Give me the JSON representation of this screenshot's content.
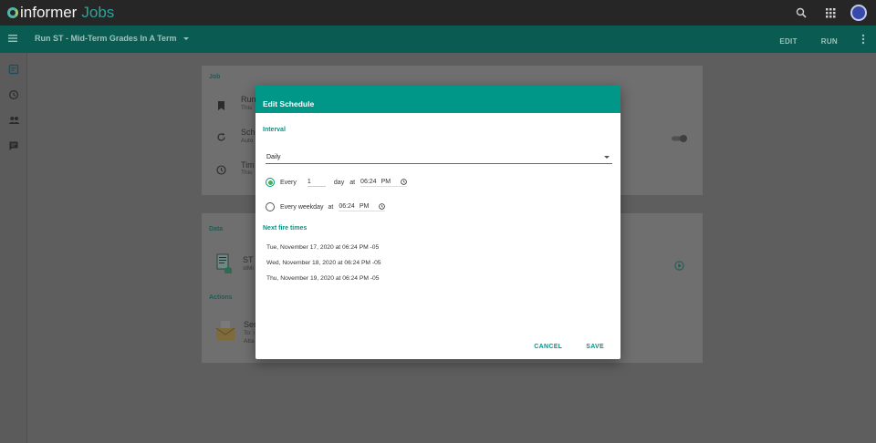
{
  "topbar": {
    "logo_text": "informer",
    "logo_sub": "Jobs"
  },
  "header": {
    "title": "Run ST - Mid-Term Grades In A Term",
    "edit_label": "EDIT",
    "run_label": "RUN"
  },
  "background": {
    "job_section": "Job",
    "row1_title": "Run",
    "row1_sub": "This",
    "row2_title": "Sch",
    "row2_sub": "Auto",
    "row3_title": "Tim",
    "row3_sub": "This",
    "data_section": "Data",
    "data_title": "ST -",
    "data_sub": "stMi",
    "actions_section": "Actions",
    "action_title": "Sen",
    "action_sub1": "To: \\",
    "action_sub2": "Atta"
  },
  "dialog": {
    "title": "Edit Schedule",
    "interval_label": "Interval",
    "interval_value": "Daily",
    "every_label": "Every",
    "every_value": "1",
    "day_label": "day",
    "at_label": "at",
    "time_value": "06:24",
    "time_ampm": "PM",
    "weekday_label": "Every weekday",
    "weekday_at_label": "at",
    "weekday_time": "06:24",
    "weekday_ampm": "PM",
    "next_fire_label": "Next fire times",
    "fire_times": [
      "Tue, November 17, 2020 at 06:24 PM -05",
      "Wed, November 18, 2020 at 06:24 PM -05",
      "Thu, November 19, 2020 at 06:24 PM -05"
    ],
    "cancel_label": "CANCEL",
    "save_label": "SAVE"
  },
  "colors": {
    "accent": "#009688",
    "header": "#0a5c53",
    "topbar": "#262626"
  }
}
